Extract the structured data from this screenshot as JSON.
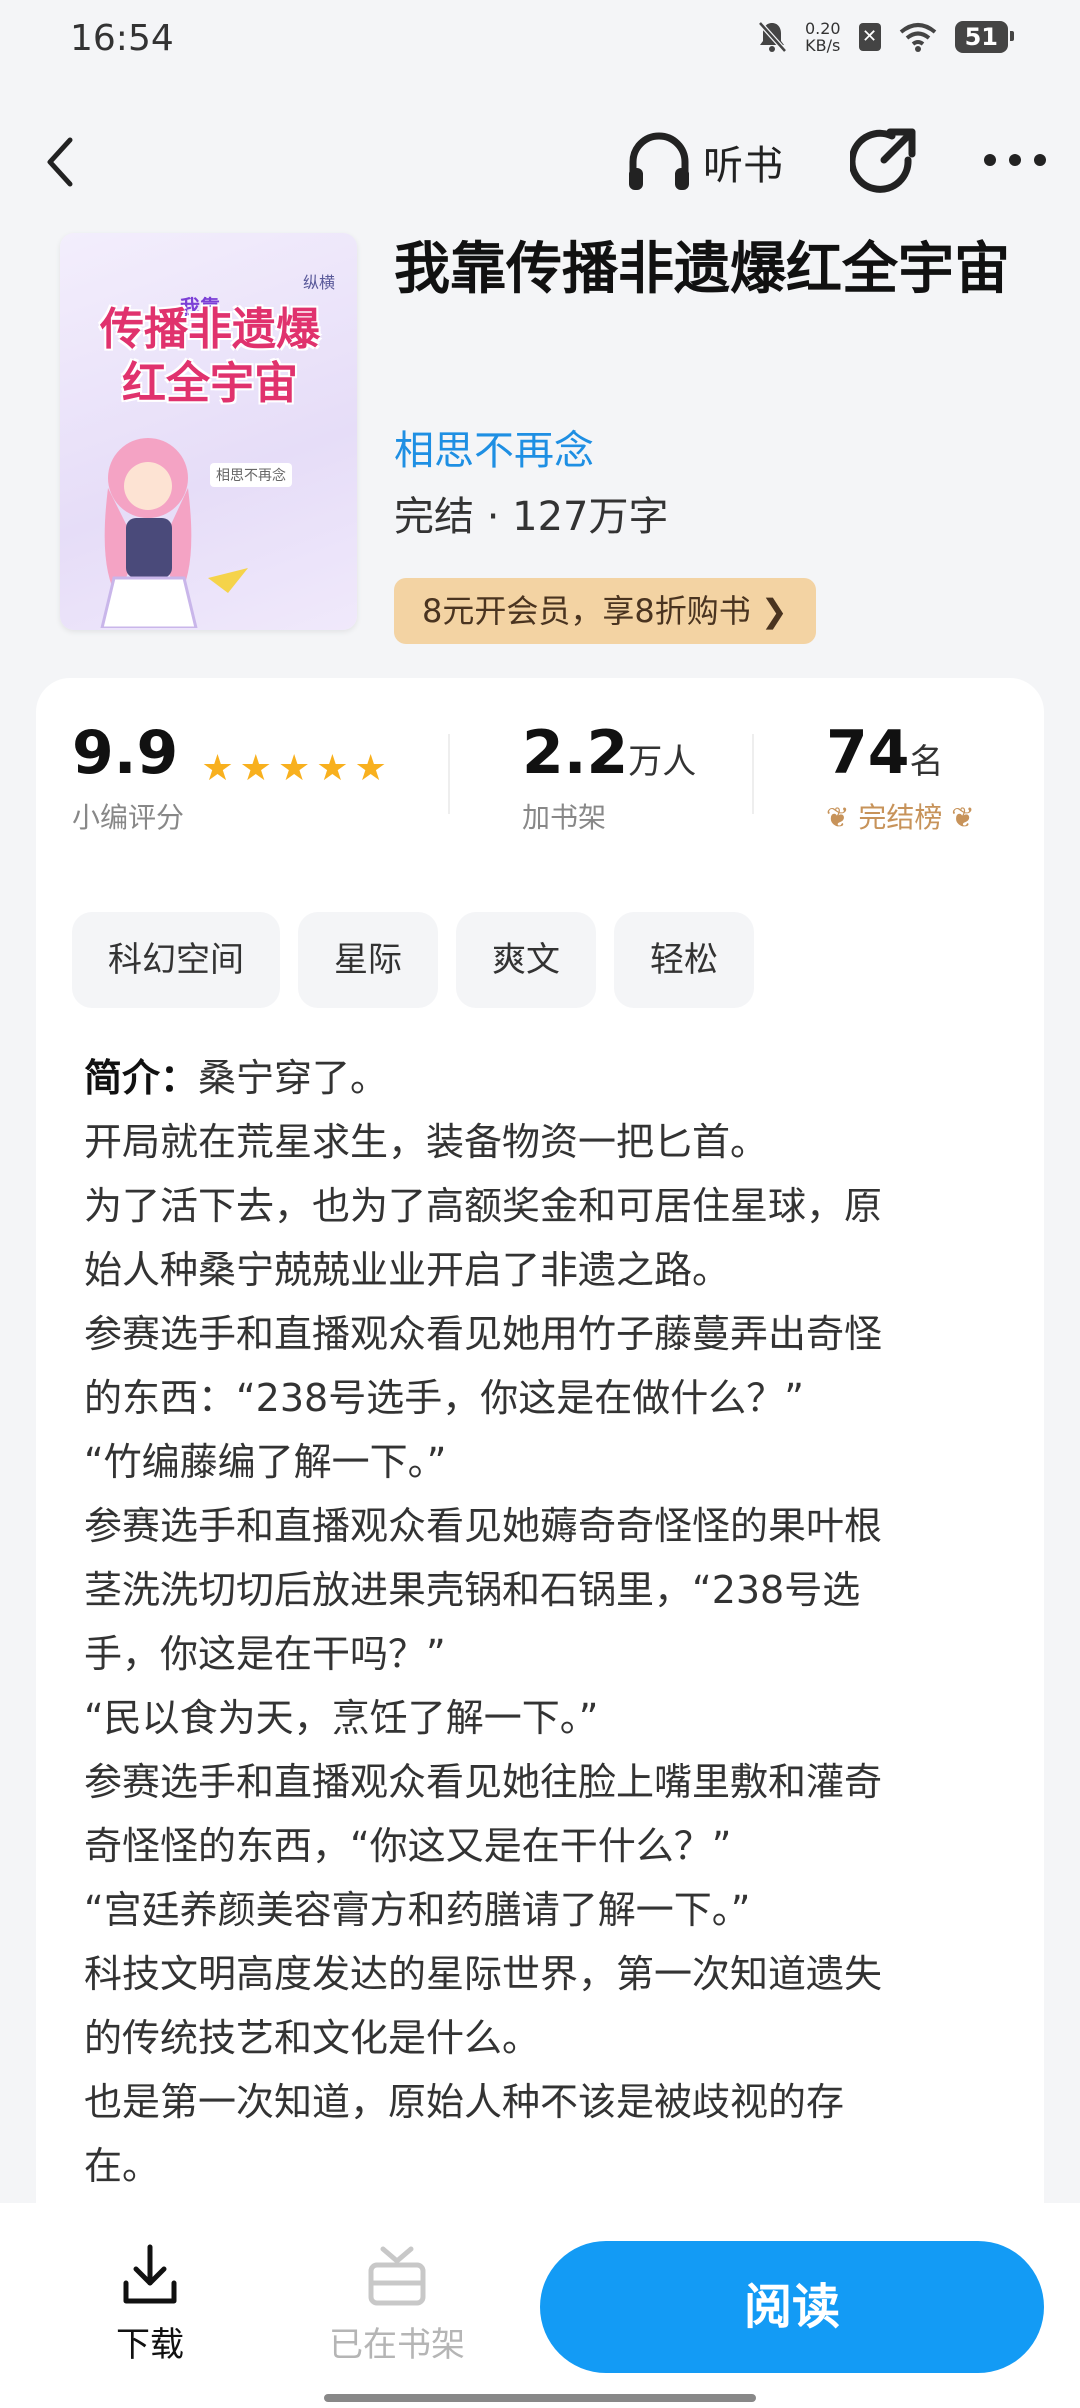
{
  "status_bar": {
    "time": "16:54",
    "net_speed_value": "0.20",
    "net_speed_unit": "KB/s",
    "battery": "51",
    "icons": [
      "bell-muted-icon",
      "sim-x-icon",
      "wifi-icon",
      "battery-icon"
    ]
  },
  "nav": {
    "listen_label": "听书",
    "icons": [
      "back-icon",
      "headphones-icon",
      "share-icon",
      "more-icon"
    ]
  },
  "book": {
    "title": "我靠传播非遗爆红全宇宙",
    "author": "相思不再念",
    "meta": "完结 · 127万字",
    "vip_offer": "8元开会员，享8折购书 ❯",
    "cover": {
      "small_text": "我靠",
      "title": "传播非遗爆红全宇宙",
      "author": "相思不再念",
      "logo": "纵横"
    }
  },
  "stats": {
    "rating": {
      "value": "9.9",
      "label": "小编评分",
      "stars": 5
    },
    "shelf": {
      "value": "2.2",
      "unit": "万人",
      "label": "加书架"
    },
    "rank": {
      "value": "74",
      "unit": "名",
      "label": "完结榜"
    }
  },
  "tags": [
    "科幻空间",
    "星际",
    "爽文",
    "轻松"
  ],
  "synopsis": {
    "head": "简介：",
    "lines": [
      "桑宁穿了。",
      "开局就在荒星求生，装备物资一把匕首。",
      "为了活下去，也为了高额奖金和可居住星球，原",
      "始人种桑宁兢兢业业开启了非遗之路。",
      "参赛选手和直播观众看见她用竹子藤蔓弄出奇怪",
      "的东西：“238号选手，你这是在做什么？”",
      "“竹编藤编了解一下。”",
      "参赛选手和直播观众看见她薅奇奇怪怪的果叶根",
      "茎洗洗切切后放进果壳锅和石锅里，“238号选",
      "手，你这是在干吗？”",
      "“民以食为天，烹饪了解一下。”",
      "参赛选手和直播观众看见她往脸上嘴里敷和灌奇",
      "奇怪怪的东西，“你这又是在干什么？”",
      "“宫廷养颜美容膏方和药膳请了解一下。”",
      "科技文明高度发达的星际世界，第一次知道遗失",
      "的传统技艺和文化是什么。",
      "也是第一次知道，原始人种不该是被歧视的存",
      "在。"
    ]
  },
  "bottom_bar": {
    "download_label": "下载",
    "shelf_label": "已在书架",
    "read_label": "阅读"
  },
  "colors": {
    "accent": "#139bf5",
    "author_link": "#1e8fe3",
    "star": "#f8b01e",
    "vip_bg": "#f3d3a3",
    "rank_label": "#c7935a"
  }
}
